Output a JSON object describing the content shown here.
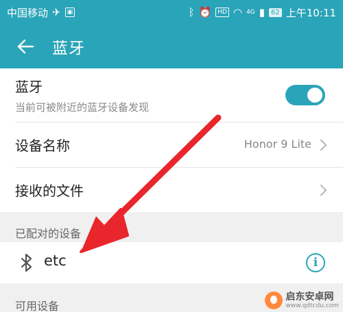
{
  "status_bar": {
    "carrier": "中国移动",
    "battery": "62",
    "time": "上午10:11",
    "network": "4G"
  },
  "header": {
    "title": "蓝牙"
  },
  "bluetooth_toggle": {
    "label": "蓝牙",
    "description": "当前可被附近的蓝牙设备发现",
    "enabled": true
  },
  "device_name": {
    "label": "设备名称",
    "value": "Honor 9 Lite"
  },
  "received_files": {
    "label": "接收的文件"
  },
  "paired_devices": {
    "header": "已配对的设备",
    "items": [
      {
        "name": "etc"
      }
    ]
  },
  "available_devices": {
    "header": "可用设备"
  },
  "watermark": {
    "name": "启东安卓网",
    "url": "www.qdtcdu.com"
  },
  "colors": {
    "accent": "#2aa4b8",
    "annotation_arrow": "#e8262c"
  }
}
